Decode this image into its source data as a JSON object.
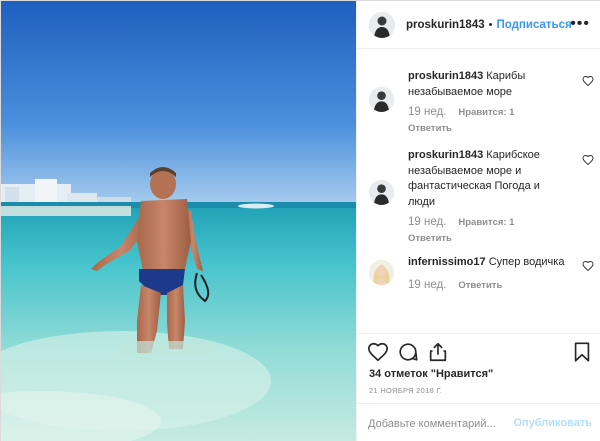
{
  "post": {
    "username": "proskurin1843",
    "dot": "•",
    "follow_label": "Подписаться",
    "more_label": "•••"
  },
  "comments": [
    {
      "username": "proskurin1843",
      "text": "Карибы незабываемое море",
      "time": "19 нед.",
      "likes": "Нравится: 1",
      "reply": "Ответить",
      "avatar": "man-avatar"
    },
    {
      "username": "proskurin1843",
      "text": "Карибское незабываемое море и фантастическая Погода и люди",
      "time": "19 нед.",
      "likes": "Нравится: 1",
      "reply": "Ответить",
      "avatar": "man-avatar"
    },
    {
      "username": "infernissimo17",
      "text": "Супер водичка",
      "time": "19 нед.",
      "reply": "Ответить",
      "avatar": "blonde-woman-avatar"
    }
  ],
  "actions": {
    "likes_count": "34 отметок \"Нравится\"",
    "date": "21 НОЯБРЯ 2018 Г.",
    "icons": [
      "heart-icon",
      "comment-icon",
      "share-icon",
      "bookmark-icon"
    ]
  },
  "add_comment": {
    "placeholder": "Добавьте комментарий...",
    "publish_label": "Опубликовать"
  },
  "colors": {
    "accent": "#3897f0",
    "publish_disabled": "#b2dffc",
    "text": "#262626",
    "muted": "#8e8e8e",
    "border": "#efefef"
  }
}
